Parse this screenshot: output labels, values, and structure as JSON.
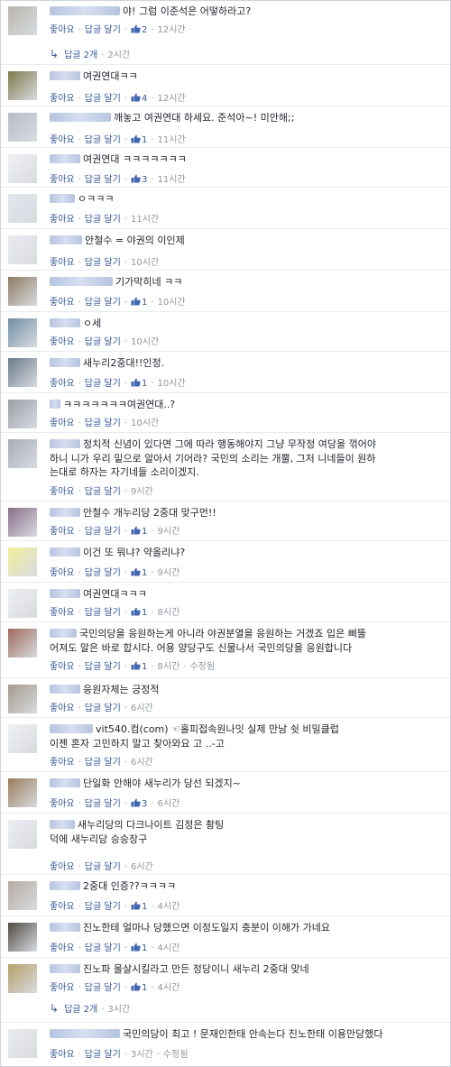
{
  "ui": {
    "like": "좋아요",
    "reply": "답글 달기",
    "sep": "·",
    "edited": "수정됨"
  },
  "colors": {
    "link": "#365899",
    "meta": "#90949c",
    "text": "#1d2129"
  },
  "comments": [
    {
      "text": "야! 그럼 이준석은 어떻하라고?",
      "likes": "2",
      "time": "12시간"
    },
    {
      "text": "여권연대ㅋㅋ",
      "likes": "4",
      "time": "12시간"
    },
    {
      "text": "깨놓고 여권연대 하세요. 준석아~! 미안해;;",
      "likes": "1",
      "time": "11시간"
    },
    {
      "text": "여권연대 ㅋㅋㅋㅋㅋㅋㅋ",
      "likes": "3",
      "time": "11시간"
    },
    {
      "text": "ㅇㅋㅋㅋ",
      "time": "11시간"
    },
    {
      "text": "안철수 = 야권의 이인제",
      "time": "10시간"
    },
    {
      "text": "기가막히네 ㅋㅋ",
      "likes": "1",
      "time": "10시간"
    },
    {
      "text": "ㅇ세",
      "time": "10시간"
    },
    {
      "text": "새누리2중대!!인정.",
      "likes": "1",
      "time": "10시간"
    },
    {
      "text": "ㅋㅋㅋㅋㅋㅋㅋ여권연대..?",
      "time": "10시간"
    },
    {
      "text": "정치적 신념이 있다면 그에 따라 행동해야지 그냥 무작정 여당을 꺾어야",
      "cont": [
        "하니 니가 우리 밑으로 알아서 기어라? 국민의 소리는 개뿔, 그저 니네들이 원하",
        "는대로 하자는 자기네들 소리이겠지."
      ],
      "time": "9시간"
    },
    {
      "text": "안철수 개누리당 2중대 맞구먼!!",
      "likes": "1",
      "time": "9시간"
    },
    {
      "text": "이건 또 뭐냐? 약올리냐?",
      "likes": "1",
      "time": "9시간"
    },
    {
      "text": "여권연대ㅋㅋㅋ",
      "likes": "1",
      "time": "8시간"
    },
    {
      "text": "국민의당을 응원하는게 아니라 야권분열을 응원하는 거겠죠 입은 삐뚤",
      "cont": [
        "어져도 말은 바로 합시다. 어용 양당구도 신물나서 국민의당을 응원합니다"
      ],
      "likes": "1",
      "time": "8시간",
      "edited": true
    },
    {
      "text": "응원자체는 긍정적",
      "time": "6시간"
    },
    {
      "text": "vit540.컴(com) ☜홀피접속원나잇 실제 만남 쉿 비밀클럽",
      "cont": [
        "이젠 혼자 고민하지 말고 찾아와요 고 ..-고"
      ],
      "time": "6시간"
    },
    {
      "text": "단일화 안해야 새누리가 당선 되겠지~",
      "likes": "3",
      "time": "6시간"
    },
    {
      "text": "새누리당의 다크나이트 김정은 촹팅",
      "cont": [
        "덕에 새누리당 승승장구"
      ],
      "time": "6시간"
    },
    {
      "text": "2중대 인증??ㅋㅋㅋㅋ",
      "likes": "1",
      "time": "4시간"
    },
    {
      "text": "진노한테 얼마나 당했으면 이정도일지 충분이 이해가 가네요",
      "likes": "1",
      "time": "4시간"
    },
    {
      "text": "진노파 몰살시킬라고 만든 정당이니 새누리 2중대 맞네",
      "likes": "1",
      "time": "4시간"
    },
    {
      "text": "국민의당이 최고 ! 문재인한태 안속는다 진노한태 이용만당했다",
      "time": "3시간",
      "edited": true
    }
  ],
  "replies": [
    {
      "label": "답글 2개",
      "time": "2시간"
    },
    {
      "label": "답글 2개",
      "time": "3시간"
    }
  ]
}
